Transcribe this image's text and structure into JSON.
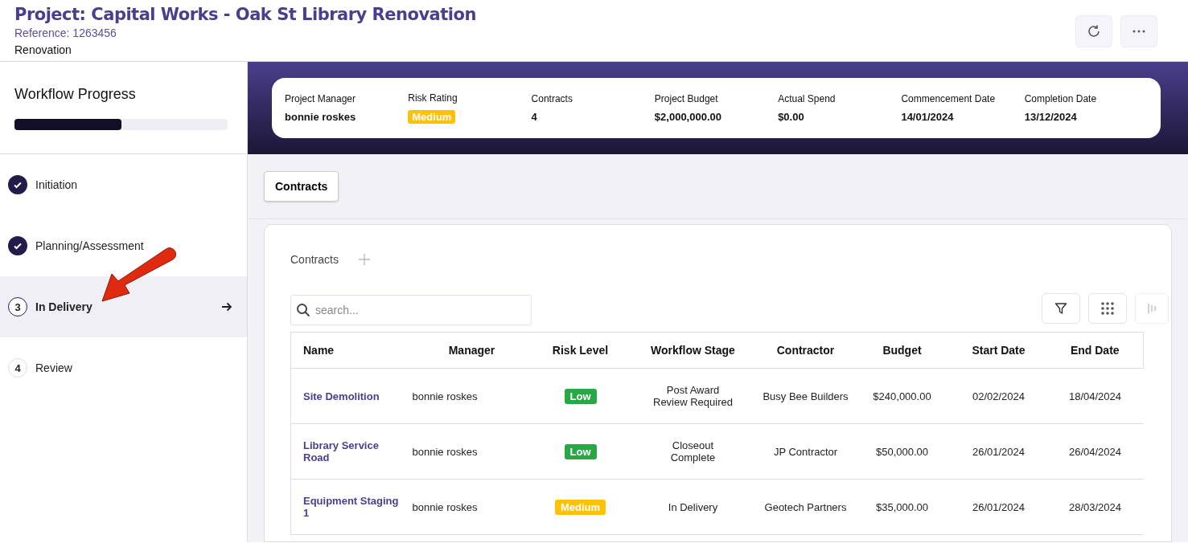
{
  "header": {
    "title": "Project: Capital Works - Oak St Library Renovation",
    "reference": "Reference: 1263456",
    "type": "Renovation"
  },
  "sidebar": {
    "title": "Workflow Progress",
    "level": 0.5,
    "steps": [
      {
        "label": "Initiation",
        "kind": "done",
        "selected": false
      },
      {
        "label": "Planning/Assessment",
        "kind": "done",
        "selected": false
      },
      {
        "marker": "3",
        "label": "In Delivery",
        "kind": "current",
        "selected": true
      },
      {
        "marker": "4",
        "label": "Review",
        "kind": "todo",
        "selected": false
      }
    ]
  },
  "summary": [
    {
      "label": "Project Manager",
      "value": "bonnie roskes",
      "kind": "text"
    },
    {
      "label": "Risk Rating",
      "value": "Medium",
      "kind": "badge",
      "color": "#ffc107"
    },
    {
      "label": "Contracts",
      "value": "4",
      "kind": "text"
    },
    {
      "label": "Project Budget",
      "value": "$2,000,000.00",
      "kind": "text"
    },
    {
      "label": "Actual Spend",
      "value": "$0.00",
      "kind": "text"
    },
    {
      "label": "Commencement Date",
      "value": "14/01/2024",
      "kind": "text"
    },
    {
      "label": "Completion Date",
      "value": "13/12/2024",
      "kind": "text"
    }
  ],
  "tabs": [
    {
      "label": "Contracts",
      "selected": true
    }
  ],
  "contracts": {
    "title": "Contracts",
    "search": {
      "placeholder": "search..."
    },
    "table": {
      "columns": [
        "Name",
        "Manager",
        "Risk Level",
        "Workflow Stage",
        "Contractor",
        "Budget",
        "Start Date",
        "End Date"
      ],
      "rows": [
        {
          "name": "Site Demolition",
          "manager": "bonnie roskes",
          "risk": "Low",
          "color": "#28a745",
          "stage": "Post Award Review Required",
          "contractor": "Busy Bee Builders",
          "budget": "$240,000.00",
          "start": "02/02/2024",
          "end": "18/04/2024"
        },
        {
          "name": "Library Service Road",
          "manager": "bonnie roskes",
          "risk": "Low",
          "color": "#28a745",
          "stage": "Closeout Complete",
          "contractor": "JP Contractor",
          "budget": "$50,000.00",
          "start": "26/01/2024",
          "end": "26/04/2024"
        },
        {
          "name": "Equipment Staging 1",
          "manager": "bonnie roskes",
          "risk": "Medium",
          "color": "#ffc107",
          "stage": "In Delivery",
          "contractor": "Geotech Partners",
          "budget": "$35,000.00",
          "start": "26/01/2024",
          "end": "28/03/2024"
        }
      ]
    }
  }
}
